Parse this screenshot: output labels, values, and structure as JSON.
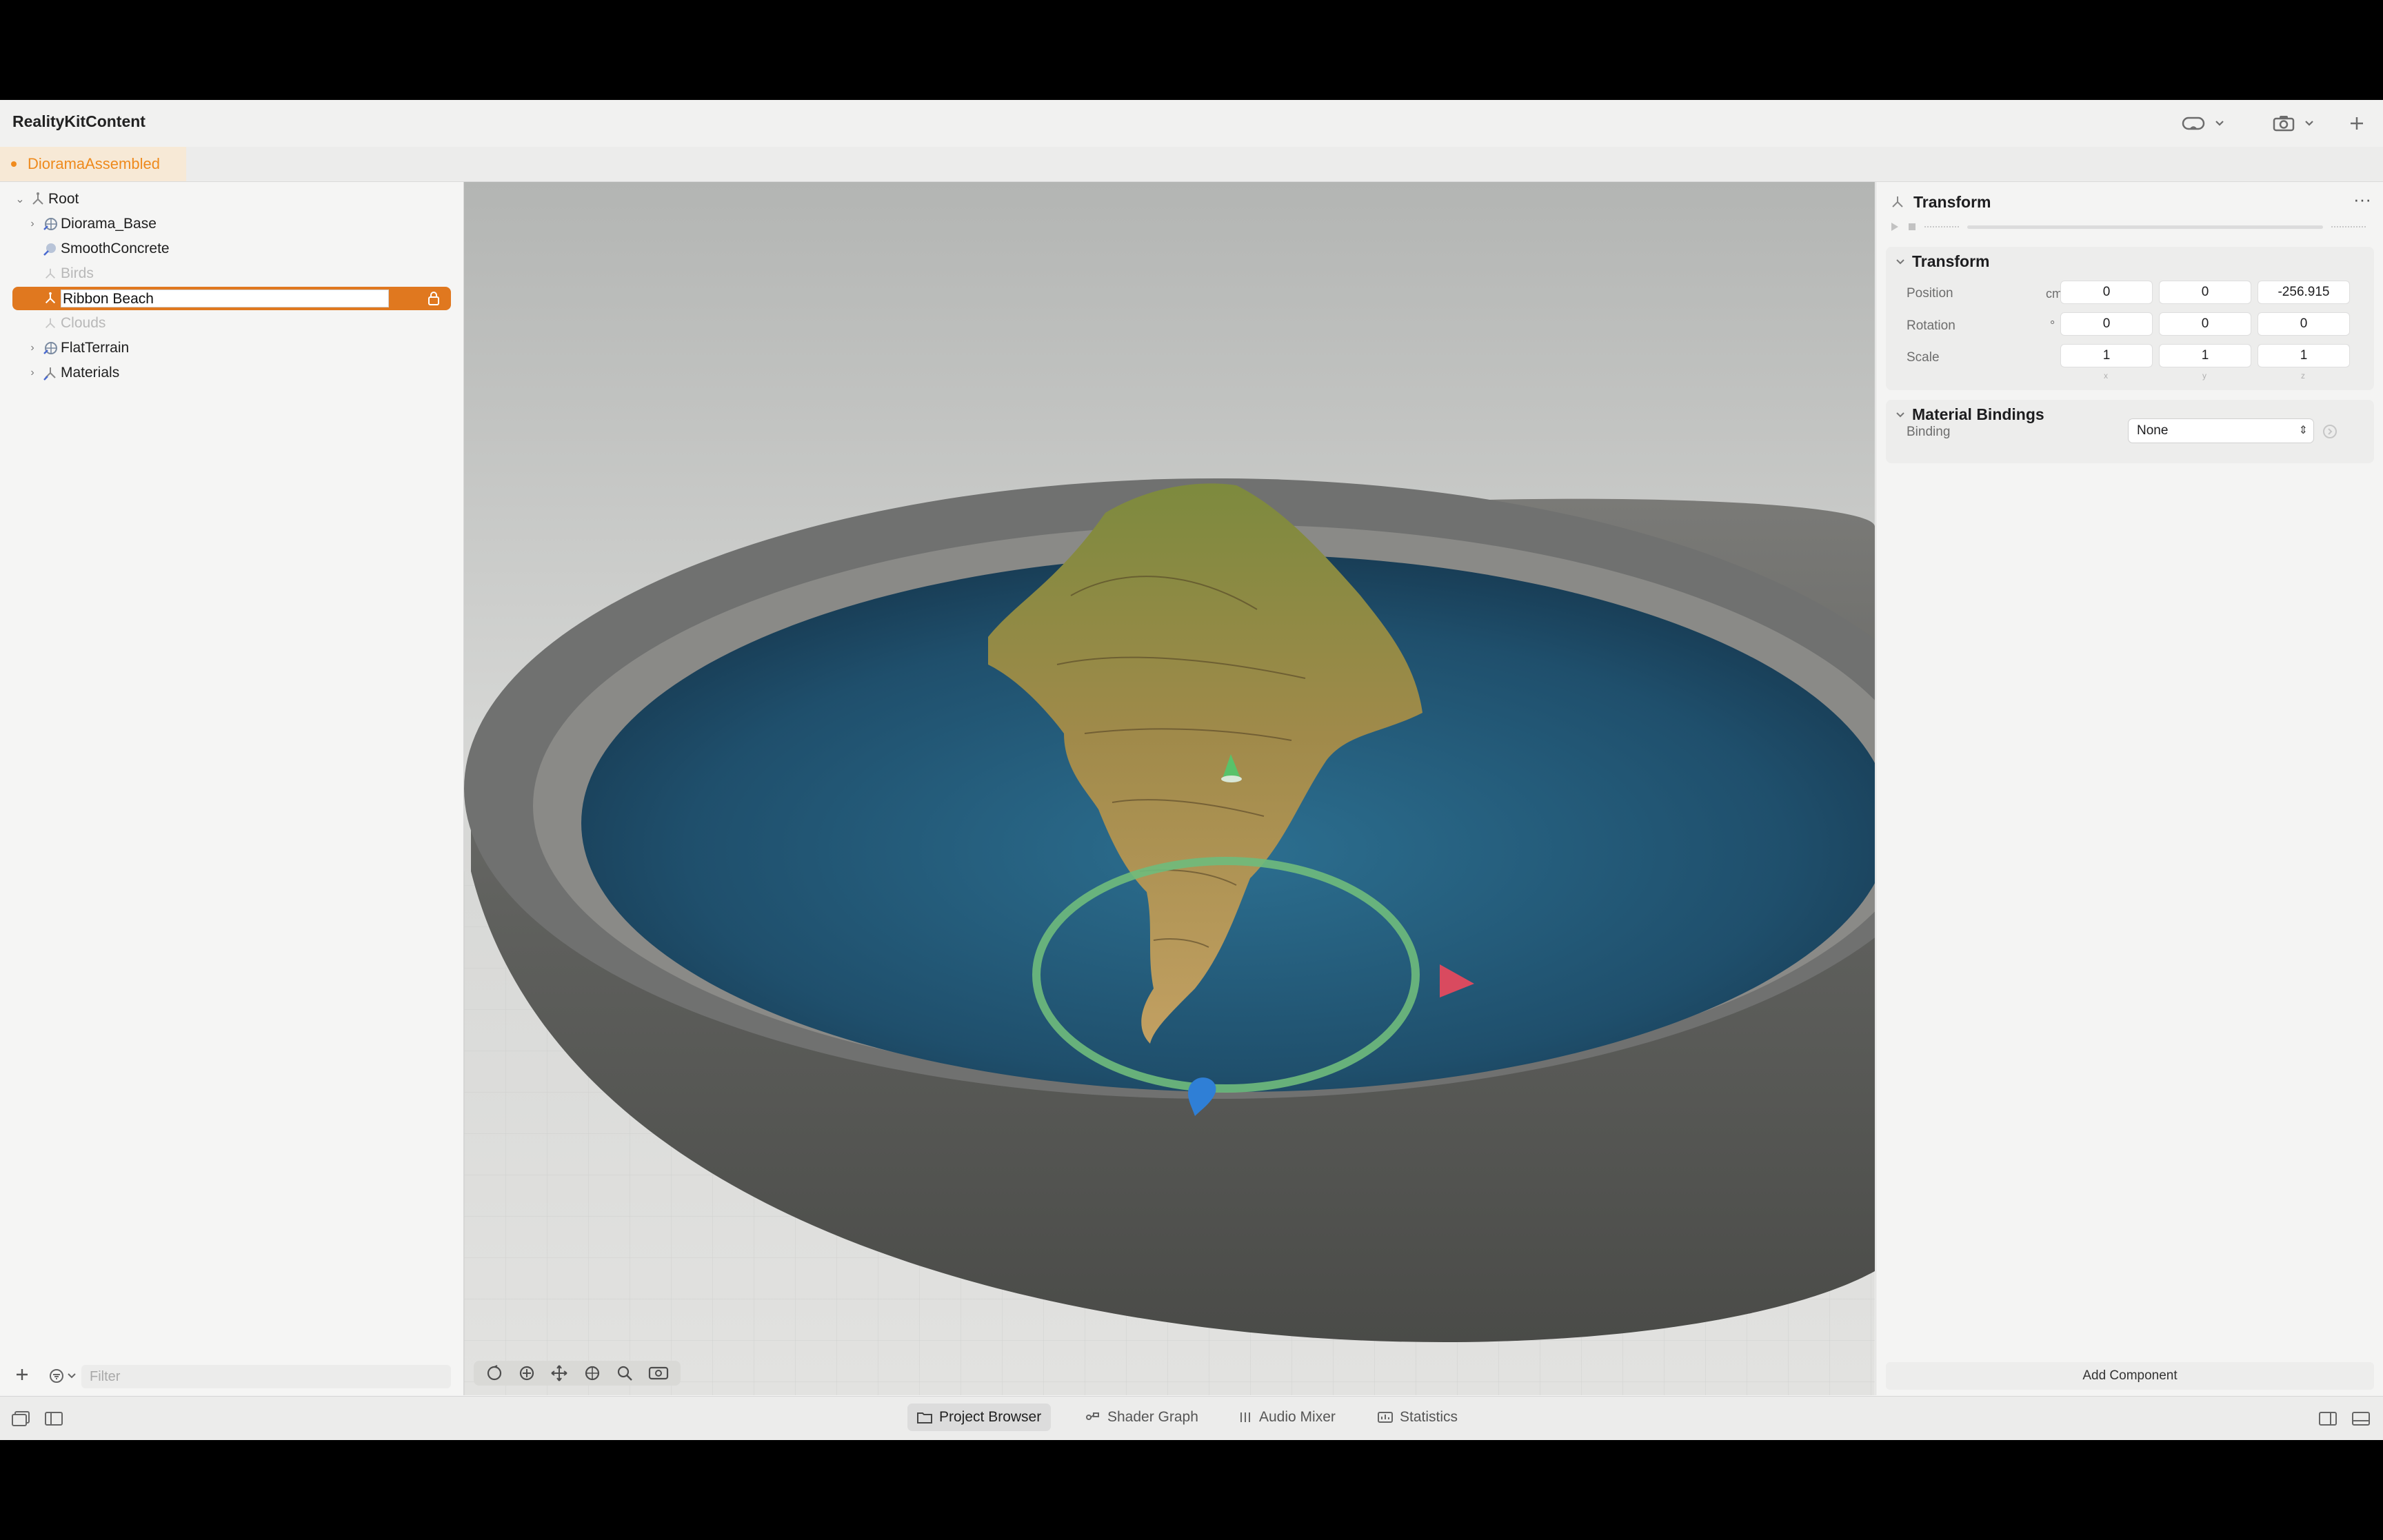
{
  "app": {
    "title": "RealityKitContent"
  },
  "toolbar": {
    "headset_icon": "visionpro-icon",
    "camera_icon": "camera-icon",
    "add_icon": "plus-icon"
  },
  "document_tab": {
    "label": "DioramaAssembled",
    "modified_color": "#f08b1e"
  },
  "hierarchy": {
    "items": [
      {
        "label": "Root",
        "expanded": true
      },
      {
        "label": "Diorama_Base"
      },
      {
        "label": "SmoothConcrete"
      },
      {
        "label": "Birds",
        "disabled": true
      },
      {
        "label": "Ribbon Beach",
        "selected": true,
        "editing": true
      },
      {
        "label": "Clouds",
        "disabled": true
      },
      {
        "label": "FlatTerrain"
      },
      {
        "label": "Materials"
      }
    ],
    "filter_placeholder": "Filter"
  },
  "inspector": {
    "header_title": "Transform",
    "transform": {
      "title": "Transform",
      "position": {
        "label": "Position",
        "unit": "cm",
        "x": "0",
        "y": "0",
        "z": "-256.915"
      },
      "rotation": {
        "label": "Rotation",
        "unit": "°",
        "x": "0",
        "y": "0",
        "z": "0"
      },
      "scale": {
        "label": "Scale",
        "x": "1",
        "y": "1",
        "z": "1"
      },
      "axis_labels": [
        "x",
        "y",
        "z"
      ]
    },
    "material_bindings": {
      "title": "Material Bindings",
      "binding_label": "Binding",
      "binding_value": "None"
    },
    "add_component": "Add Component"
  },
  "bottom_tabs": [
    {
      "label": "Project Browser",
      "active": true
    },
    {
      "label": "Shader Graph"
    },
    {
      "label": "Audio Mixer"
    },
    {
      "label": "Statistics"
    }
  ],
  "colors": {
    "accent": "#e0781f",
    "selection": "#e0781f",
    "gizmo_x": "#d94a5f",
    "gizmo_y": "#4bbf63",
    "gizmo_z": "#2f7fd6"
  }
}
